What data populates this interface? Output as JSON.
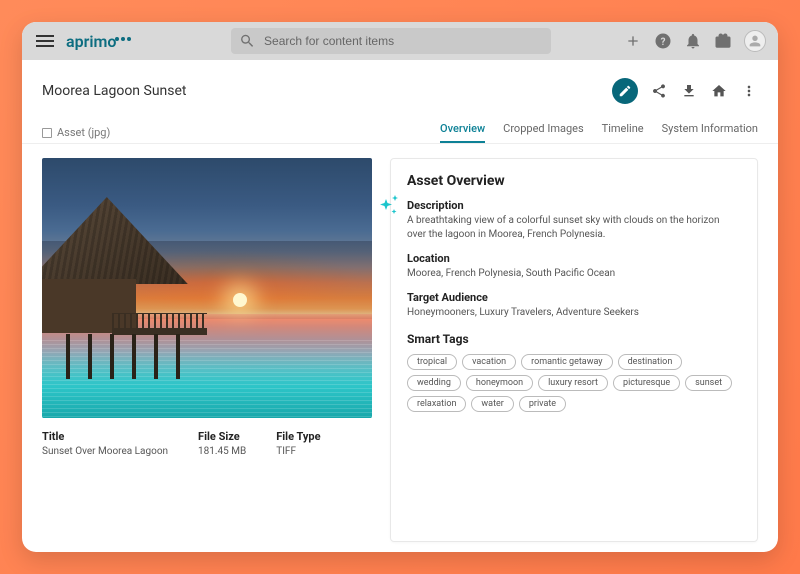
{
  "brand": "aprimo",
  "search": {
    "placeholder": "Search for content items"
  },
  "header": {
    "title": "Moorea Lagoon Sunset"
  },
  "asset_check": {
    "label": "Asset (jpg)"
  },
  "tabs": [
    {
      "label": "Overview",
      "active": true
    },
    {
      "label": "Cropped Images",
      "active": false
    },
    {
      "label": "Timeline",
      "active": false
    },
    {
      "label": "System Information",
      "active": false
    }
  ],
  "meta": {
    "title_label": "Title",
    "title_value": "Sunset Over Moorea Lagoon",
    "size_label": "File Size",
    "size_value": "181.45 MB",
    "type_label": "File Type",
    "type_value": "TIFF"
  },
  "overview": {
    "panel_title": "Asset Overview",
    "description_label": "Description",
    "description_value": "A breathtaking view of a colorful sunset sky with clouds on the horizon over the lagoon in Moorea, French Polynesia.",
    "location_label": "Location",
    "location_value": "Moorea, French Polynesia, South Pacific Ocean",
    "audience_label": "Target Audience",
    "audience_value": "Honeymooners, Luxury Travelers, Adventure Seekers",
    "smart_tags_label": "Smart Tags",
    "tags": [
      "tropical",
      "vacation",
      "romantic getaway",
      "destination",
      "wedding",
      "honeymoon",
      "luxury resort",
      "picturesque",
      "sunset",
      "relaxation",
      "water",
      "private"
    ]
  }
}
